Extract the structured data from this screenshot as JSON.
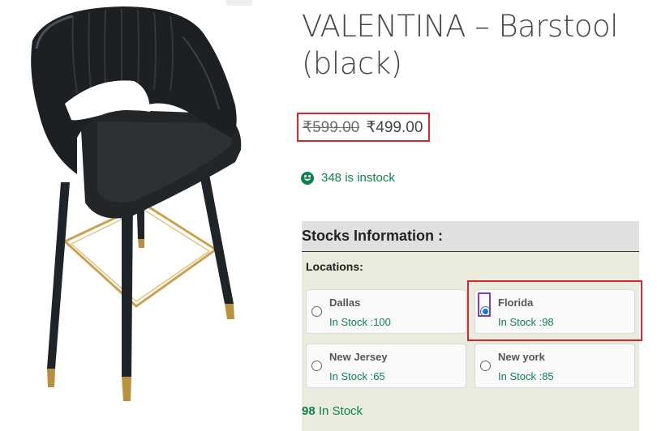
{
  "product": {
    "title": "VALENTINA – Barstool (black)",
    "price_old": "₹599.00",
    "price_new": "₹499.00",
    "stock_status": "348 is instock"
  },
  "stocks": {
    "heading": "Stocks Information :",
    "locations_label": "Locations:",
    "locations": [
      {
        "name": "Dallas",
        "qty": "In Stock :100",
        "selected": false
      },
      {
        "name": "Florida",
        "qty": "In Stock :98",
        "selected": true
      },
      {
        "name": "New Jersey",
        "qty": "In Stock :65",
        "selected": false
      },
      {
        "name": "New york",
        "qty": "In Stock :85",
        "selected": false
      }
    ],
    "selected_count": "98",
    "selected_suffix": " In Stock"
  },
  "icons": {
    "zoom": "magnify-icon",
    "stock": "smiley-icon"
  },
  "colors": {
    "accent_red": "#d9262e",
    "stock_green": "#0f834d",
    "radio_blue": "#1a73e8",
    "focus_purple": "#7b3fbf"
  }
}
